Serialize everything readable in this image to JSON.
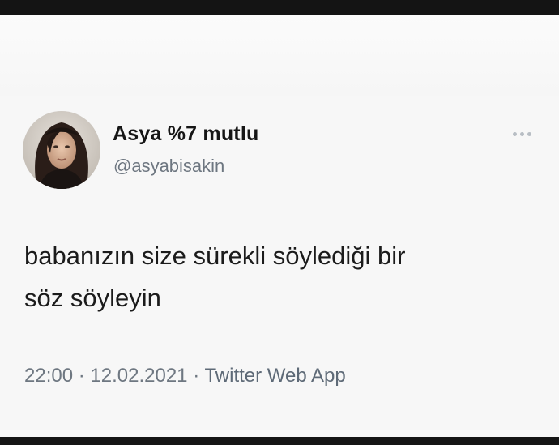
{
  "tweet": {
    "display_name": "Asya %7 mutlu",
    "handle": "@asyabisakin",
    "text": "babanızın size sürekli söylediği bir\nsöz söyleyin",
    "time": "22:00",
    "separator": "·",
    "date": "12.02.2021",
    "source": "Twitter Web App",
    "more_icon": "more-horizontal-icon"
  },
  "colors": {
    "card_background": "#f7f7f7",
    "name": "#161616",
    "secondary_text": "#6e7781"
  }
}
